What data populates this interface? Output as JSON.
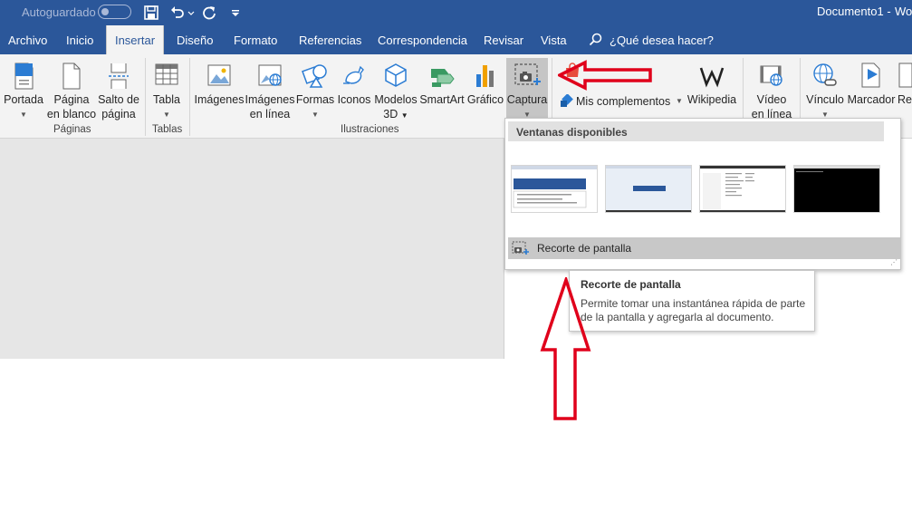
{
  "titlebar": {
    "autosave_label": "Autoguardado",
    "document_title": "Documento1  -",
    "app_title": "Wo"
  },
  "tabs": [
    {
      "label": "Archivo"
    },
    {
      "label": "Inicio"
    },
    {
      "label": "Insertar",
      "active": true
    },
    {
      "label": "Diseño"
    },
    {
      "label": "Formato"
    },
    {
      "label": "Referencias"
    },
    {
      "label": "Correspondencia"
    },
    {
      "label": "Revisar"
    },
    {
      "label": "Vista"
    }
  ],
  "tell_me": "¿Qué desea hacer?",
  "ribbon": {
    "paginas": {
      "group_label": "Páginas",
      "portada": {
        "line1": "Portada"
      },
      "pagina_blanco": {
        "line1": "Página",
        "line2": "en blanco"
      },
      "salto_pagina": {
        "line1": "Salto de",
        "line2": "página"
      }
    },
    "tablas": {
      "group_label": "Tablas",
      "tabla": {
        "line1": "Tabla"
      }
    },
    "ilustraciones": {
      "group_label": "Ilustraciones",
      "imagenes": {
        "line1": "Imágenes"
      },
      "imagenes_linea": {
        "line1": "Imágenes",
        "line2": "en línea"
      },
      "formas": {
        "line1": "Formas"
      },
      "iconos": {
        "line1": "Iconos"
      },
      "modelos3d": {
        "line1": "Modelos",
        "line2": "3D"
      },
      "smartart": {
        "line1": "SmartArt"
      },
      "grafico": {
        "line1": "Gráfico"
      },
      "captura": {
        "line1": "Captura"
      }
    },
    "complementos": {
      "mis_complementos": "Mis complementos",
      "wikipedia": "Wikipedia"
    },
    "multimedia": {
      "video_linea": {
        "line1": "Vídeo",
        "line2": "en línea"
      }
    },
    "vinculos": {
      "vinculo": {
        "line1": "Vínculo"
      },
      "marcador": {
        "line1": "Marcador"
      },
      "referencia_cruzada": {
        "line1": "Ref"
      }
    }
  },
  "captura_menu": {
    "header": "Ventanas disponibles",
    "recorte_label": "Recorte de pantalla"
  },
  "tooltip": {
    "title": "Recorte de pantalla",
    "body": "Permite tomar una instantánea rápida de parte de la pantalla y agregarla al documento."
  },
  "colors": {
    "accent": "#2b579a",
    "ribbon_bg": "#f3f3f3",
    "annotation_red": "#e0001b"
  }
}
